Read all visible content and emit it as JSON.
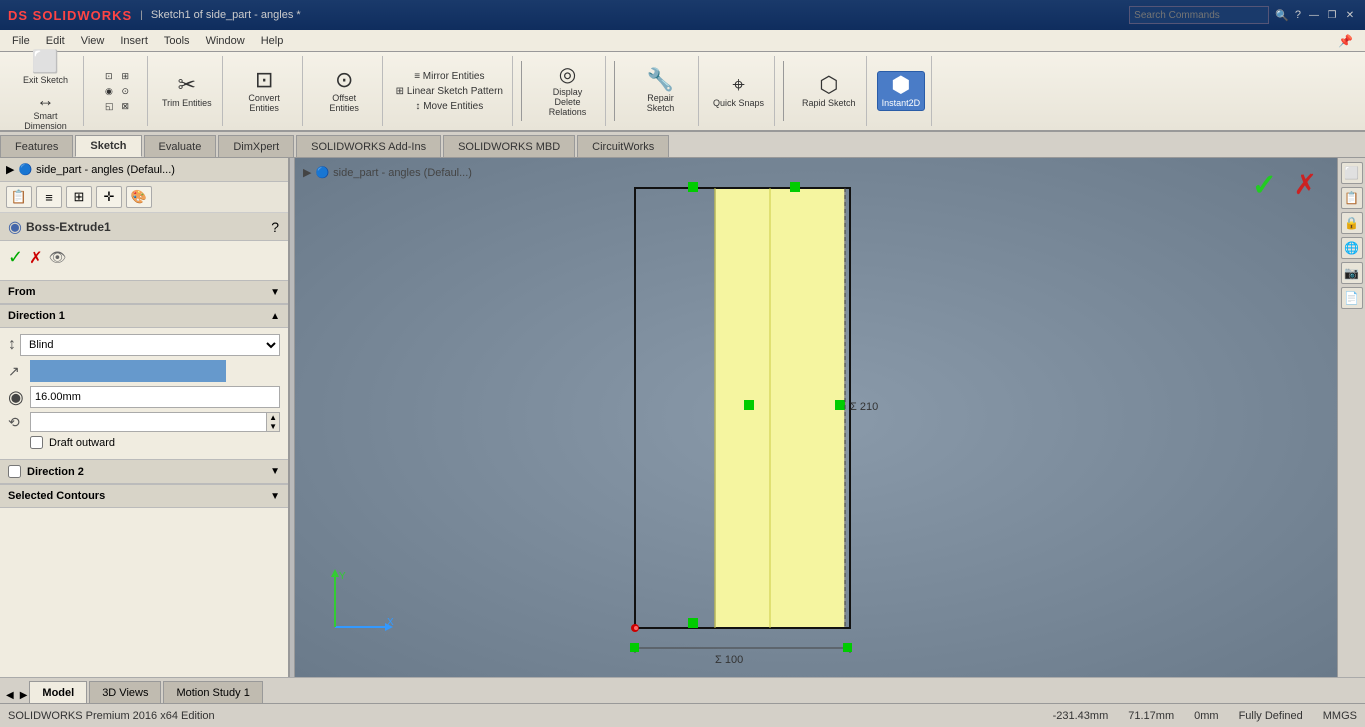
{
  "titlebar": {
    "logo": "DS SOLIDWORKS",
    "title": "Sketch1 of side_part - angles *",
    "search_placeholder": "Search Commands",
    "controls": [
      "—",
      "❐",
      "✕"
    ]
  },
  "menubar": {
    "items": [
      "File",
      "Edit",
      "View",
      "Insert",
      "Tools",
      "Window",
      "Help"
    ]
  },
  "toolbar": {
    "groups": [
      {
        "items": [
          {
            "icon": "⬜",
            "label": "Exit Sketch"
          },
          {
            "icon": "↔",
            "label": "Smart Dimension"
          }
        ]
      },
      {
        "items": [
          {
            "icon": "◱",
            "label": "Trim Entities"
          },
          {
            "icon": "⊡",
            "label": "Convert Entities"
          },
          {
            "icon": "⊙",
            "label": "Offset Entities"
          }
        ]
      },
      {
        "items": [
          {
            "icon": "≡",
            "label": "Mirror Entities"
          },
          {
            "icon": "⊞",
            "label": "Linear Sketch Pattern"
          },
          {
            "icon": "↕",
            "label": "Move Entities"
          }
        ]
      },
      {
        "items": [
          {
            "icon": "◎",
            "label": "Display Delete Relations"
          }
        ]
      },
      {
        "items": [
          {
            "icon": "✎",
            "label": "Repair Sketch"
          }
        ]
      },
      {
        "items": [
          {
            "icon": "⌖",
            "label": "Quick Snaps"
          }
        ]
      },
      {
        "items": [
          {
            "icon": "⬡",
            "label": "Rapid Sketch"
          }
        ]
      },
      {
        "items": [
          {
            "icon": "⬢",
            "label": "Instant2D",
            "active": true
          }
        ]
      }
    ]
  },
  "tabs": {
    "items": [
      "Features",
      "Sketch",
      "Evaluate",
      "DimXpert",
      "SOLIDWORKS Add-Ins",
      "SOLIDWORKS MBD",
      "CircuitWorks"
    ],
    "active": "Sketch"
  },
  "prop_panel": {
    "title": "Boss-Extrude1",
    "help_label": "?",
    "toolbar_icons": [
      "📋",
      "≡",
      "💾",
      "✛",
      "🎨"
    ],
    "from_label": "From",
    "direction1_label": "Direction 1",
    "direction_type": "Blind",
    "depth_value": "16.00mm",
    "direction2_label": "Direction 2",
    "selected_contours_label": "Selected Contours",
    "draft_outward_label": "Draft outward"
  },
  "viewport": {
    "tree_path": "side_part - angles  (Defaul...)",
    "arrow": "▶"
  },
  "bottom_tabs": {
    "items": [
      "Model",
      "3D Views",
      "Motion Study 1"
    ],
    "active": "Model"
  },
  "statusbar": {
    "left": "SOLIDWORKS Premium 2016 x64 Edition",
    "coords": {
      "x": "-231.43mm",
      "y": "71.17mm",
      "z": "0mm"
    },
    "status": "Fully Defined",
    "units": "MMGS"
  },
  "toolbar2": {
    "icons": [
      "🔍",
      "🔎",
      "✏",
      "📐",
      "🔧",
      "⚙",
      "◉",
      "👁",
      "◻",
      "💡",
      "📺"
    ]
  }
}
